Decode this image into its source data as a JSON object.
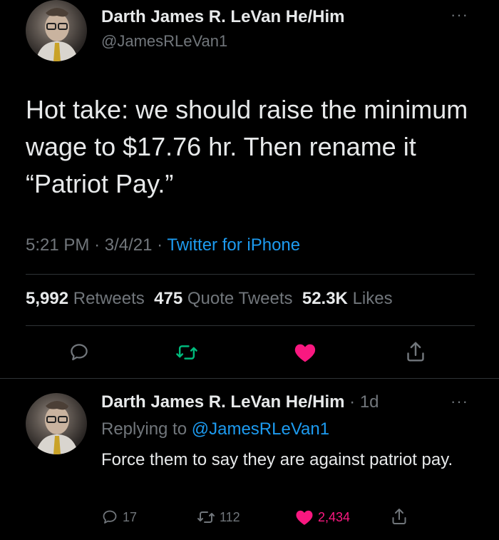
{
  "main_tweet": {
    "author_name": "Darth James R. LeVan He/Him",
    "handle": "@JamesRLeVan1",
    "more_label": "···",
    "text": "Hot take: we should raise the minimum wage to $17.76 hr. Then rename it “Patriot Pay.”",
    "time": "5:21 PM",
    "date": "3/4/21",
    "sep": "·",
    "client": "Twitter for iPhone",
    "stats": {
      "retweets_count": "5,992",
      "retweets_label": "Retweets",
      "quotes_count": "475",
      "quotes_label": "Quote Tweets",
      "likes_count": "52.3K",
      "likes_label": "Likes"
    },
    "actions": {
      "reply_icon": "reply-icon",
      "retweet_icon": "retweet-icon",
      "like_icon": "heart-icon",
      "share_icon": "share-icon"
    }
  },
  "reply_tweet": {
    "author_name": "Darth James R. LeVan He/Him",
    "age": "1d",
    "sep": "·",
    "more_label": "···",
    "replying_label": "Replying to",
    "replying_handle": "@JamesRLeVan1",
    "text": "Force them to say they are against patriot pay.",
    "actions": {
      "replies_count": "17",
      "retweets_count": "112",
      "likes_count": "2,434"
    }
  },
  "colors": {
    "background": "#000000",
    "text": "#e7e9ea",
    "muted": "#71767b",
    "accent": "#1d9bf0",
    "retweet_green": "#00ba7c",
    "like_pink": "#f91880",
    "divider": "#2f3336"
  }
}
